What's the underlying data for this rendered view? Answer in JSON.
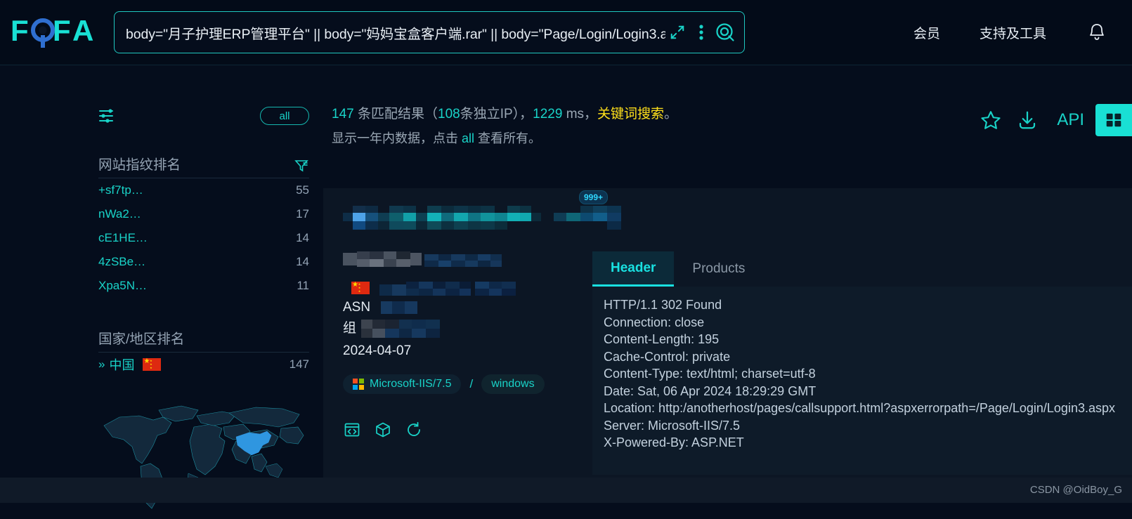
{
  "brand": {
    "name": "FOFA"
  },
  "search": {
    "query": "body=\"月子护理ERP管理平台\" || body=\"妈妈宝盒客户端.rar\" || body=\"Page/Login/Login3.a",
    "expand_icon": "expand-arrows-icon",
    "menu_icon": "vertical-dots-icon",
    "search_icon": "search-icon"
  },
  "nav": {
    "items": [
      {
        "label": "会员",
        "name": "nav-member"
      },
      {
        "label": "支持及工具",
        "name": "nav-support-tools"
      }
    ],
    "bell_icon": "bell-icon"
  },
  "sidebar": {
    "filter_icon": "sliders-filter-icon",
    "all_label": "all",
    "fingerprint": {
      "title": "网站指纹排名",
      "filter_icon": "funnel-filter-icon",
      "items": [
        {
          "label": "+sf7tp…",
          "value": "55"
        },
        {
          "label": "nWa2…",
          "value": "17"
        },
        {
          "label": "cE1HE…",
          "value": "14"
        },
        {
          "label": "4zSBe…",
          "value": "14"
        },
        {
          "label": "Xpa5N…",
          "value": "11"
        }
      ]
    },
    "country": {
      "title": "国家/地区排名",
      "items": [
        {
          "chevron": "»",
          "label": "中国",
          "flag": "cn-flag-icon",
          "value": "147"
        }
      ]
    },
    "map_name": "world-map-china-highlighted"
  },
  "results": {
    "count": "147",
    "count_suffix": "条匹配结果（",
    "unique_ip": "108",
    "unique_ip_suffix": "条独立IP），",
    "time_ms": "1229",
    "time_unit": "ms，",
    "mode": "关键词搜索",
    "period_mark": "。",
    "line2_prefix": "显示一年内数据，点击 ",
    "line2_link": "all",
    "line2_suffix": " 查看所有。",
    "tools": {
      "star_icon": "star-icon",
      "download_icon": "download-icon",
      "api_label": "API",
      "view_icon": "grid-view-icon"
    }
  },
  "card": {
    "badge": "999+",
    "asn_label": "ASN",
    "org_label": "组",
    "date": "2024-04-07",
    "tags": [
      {
        "label": "Microsoft-IIS/7.5",
        "icon": "microsoft-icon"
      },
      {
        "label": "windows",
        "icon": ""
      }
    ],
    "tag_separator": "/",
    "action_icons": [
      {
        "name": "code-window-icon"
      },
      {
        "name": "cube-icon"
      },
      {
        "name": "refresh-icon"
      }
    ],
    "tabs": [
      {
        "label": "Header",
        "active": true
      },
      {
        "label": "Products",
        "active": false
      }
    ],
    "header_lines": [
      "HTTP/1.1 302 Found",
      "Connection: close",
      "Content-Length: 195",
      "Cache-Control: private",
      "Content-Type: text/html; charset=utf-8",
      "Date: Sat, 06 Apr 2024 18:29:29 GMT",
      "Location: http:/anotherhost/pages/callsupport.html?aspxerrorpath=/Page/Login/Login3.aspx",
      "Server: Microsoft-IIS/7.5",
      "X-Powered-By: ASP.NET"
    ]
  },
  "watermark": "CSDN @OidBoy_G",
  "colors": {
    "accent": "#19d3c8",
    "bg": "#050d1c",
    "card_bg": "#0c1624",
    "yellow": "#ffe01b"
  }
}
